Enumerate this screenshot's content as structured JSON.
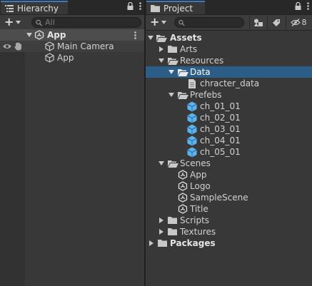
{
  "hierarchy": {
    "tab_title": "Hierarchy",
    "search_placeholder": "All",
    "plus_label": "+",
    "rows": [
      {
        "label": "App"
      },
      {
        "label": "Main Camera"
      },
      {
        "label": "App"
      }
    ]
  },
  "project": {
    "tab_title": "Project",
    "plus_label": "+",
    "search_placeholder": "",
    "hidden_count": "8",
    "tree": {
      "assets": "Assets",
      "arts": "Arts",
      "resources": "Resources",
      "data": "Data",
      "chracter_data": "chracter_data",
      "prefebs": "Prefebs",
      "prefabs": [
        "ch_01_01",
        "ch_02_01",
        "ch_03_01",
        "ch_04_01",
        "ch_05_01"
      ],
      "scenes": "Scenes",
      "scene_items": [
        "App",
        "Logo",
        "SampleScene",
        "Title"
      ],
      "scripts": "Scripts",
      "textures": "Textures",
      "packages": "Packages"
    }
  },
  "colors": {
    "selection_blue": "#2c5d87",
    "selection_gray": "#4d4d4d",
    "tab_accent": "#3a79bb",
    "prefab_blue": "#5bb3f0"
  },
  "icons": {
    "hierarchy_tab": "list-icon",
    "project_tab": "folder-icon",
    "lock": "lock-icon",
    "menu": "kebab-menu-icon",
    "search": "search-icon",
    "visibility": "eye-icon",
    "pickable": "hand-icon",
    "scene": "unity-logo-icon",
    "gameobject": "cube-icon",
    "prefab": "prefab-cube-icon",
    "folder": "folder-icon",
    "folder_open": "folder-open-icon",
    "file": "file-icon",
    "type_filter": "type-filter-icon",
    "label_filter": "label-filter-icon",
    "hidden_packages": "eye-slash-icon"
  }
}
